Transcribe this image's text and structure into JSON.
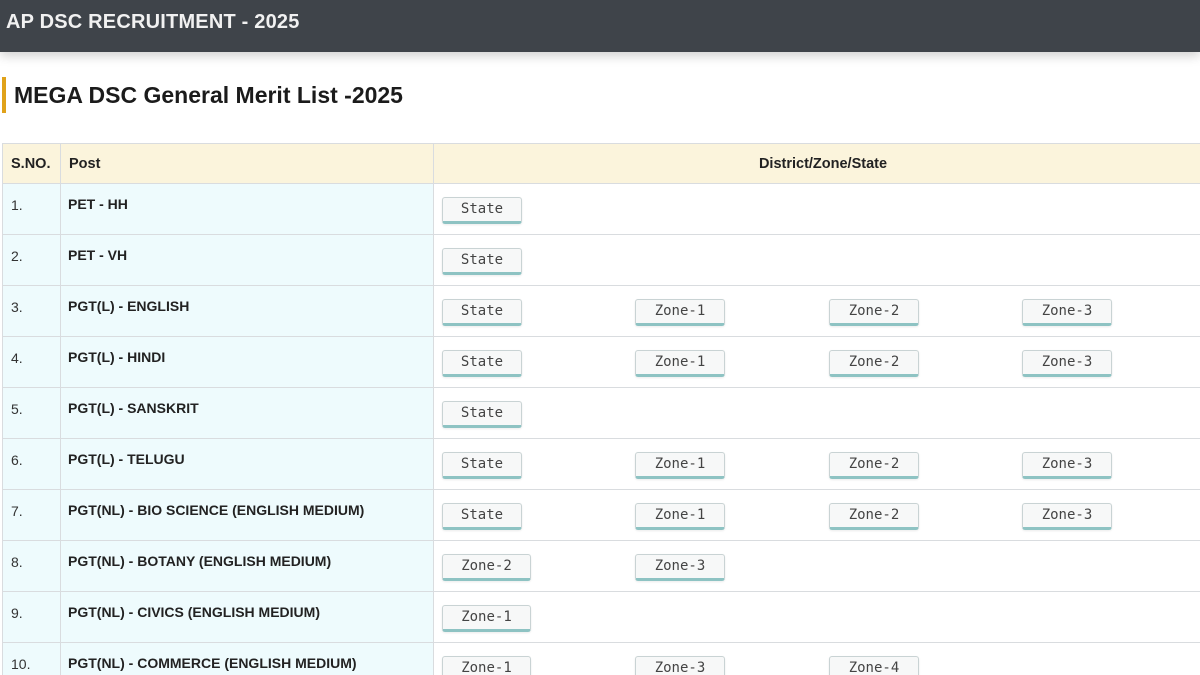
{
  "header": {
    "title": "AP DSC RECRUITMENT - 2025"
  },
  "page": {
    "title": "MEGA DSC General Merit List -2025"
  },
  "table": {
    "headers": {
      "sno": "S.NO.",
      "post": "Post",
      "district": "District/Zone/State"
    },
    "rows": [
      {
        "sno": "1.",
        "post": "PET - HH",
        "links": [
          "State"
        ]
      },
      {
        "sno": "2.",
        "post": "PET - VH",
        "links": [
          "State"
        ]
      },
      {
        "sno": "3.",
        "post": "PGT(L) - ENGLISH",
        "links": [
          "State",
          "Zone-1",
          "Zone-2",
          "Zone-3"
        ]
      },
      {
        "sno": "4.",
        "post": "PGT(L) - HINDI",
        "links": [
          "State",
          "Zone-1",
          "Zone-2",
          "Zone-3"
        ]
      },
      {
        "sno": "5.",
        "post": "PGT(L) - SANSKRIT",
        "links": [
          "State"
        ]
      },
      {
        "sno": "6.",
        "post": "PGT(L) - TELUGU",
        "links": [
          "State",
          "Zone-1",
          "Zone-2",
          "Zone-3"
        ]
      },
      {
        "sno": "7.",
        "post": "PGT(NL) - BIO SCIENCE (ENGLISH MEDIUM)",
        "links": [
          "State",
          "Zone-1",
          "Zone-2",
          "Zone-3"
        ]
      },
      {
        "sno": "8.",
        "post": "PGT(NL) - BOTANY (ENGLISH MEDIUM)",
        "links": [
          "Zone-2",
          "Zone-3"
        ]
      },
      {
        "sno": "9.",
        "post": "PGT(NL) - CIVICS (ENGLISH MEDIUM)",
        "links": [
          "Zone-1"
        ]
      },
      {
        "sno": "10.",
        "post": "PGT(NL) - COMMERCE (ENGLISH MEDIUM)",
        "links": [
          "Zone-1",
          "Zone-3",
          "Zone-4"
        ]
      }
    ]
  }
}
